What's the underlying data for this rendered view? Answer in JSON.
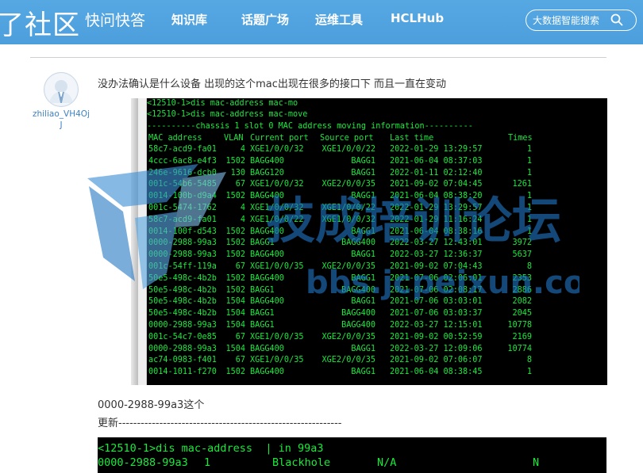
{
  "nav": {
    "brand": "了社区",
    "items": [
      "快问快答",
      "知识库",
      "话题广场",
      "运维工具",
      "HCLHub"
    ],
    "search_placeholder": "大数据智能搜索"
  },
  "post": {
    "username": "zhiliao_VH4OjJ",
    "text": "没办法确认是什么设备 出现的这个mac出现在很多的接口下 而且一直在变动",
    "mac_note": "0000-2988-99a3这个",
    "update_line": "更新------------------------------------------------------------"
  },
  "terminal1": {
    "commands": [
      "<12510-1>dis mac-address mac-mo",
      "<12510-1>dis mac-address mac-move"
    ],
    "banner": "----------chassis 1 slot 0 MAC address moving information----------",
    "headers": [
      "MAC address",
      "VLAN",
      "Current port",
      "Source port",
      "Last time",
      "Times"
    ],
    "rows": [
      [
        "58c7-acd9-fa01",
        "4",
        "XGE1/0/0/32",
        "XGE1/0/0/22",
        "2022-01-29 13:29:57",
        "1"
      ],
      [
        "4ccc-6ac8-e4f3",
        "1502",
        "BAGG400",
        "BAGG1",
        "2021-06-04 08:37:03",
        "1"
      ],
      [
        "246e-9616-dcb0",
        "130",
        "BAGG120",
        "BAGG1",
        "2022-01-11 02:12:40",
        "1"
      ],
      [
        "001c-54b6-5485",
        "67",
        "XGE1/0/0/32",
        "XGE2/0/0/35",
        "2021-09-02 07:04:45",
        "1261"
      ],
      [
        "0014-100b-d9a4",
        "1502",
        "BAGG400",
        "BAGG1",
        "2021-06-04 08:38:20",
        "1"
      ],
      [
        "001c-5474-1762",
        "4",
        "XGE1/0/0/32",
        "XGE1/0/0/22",
        "2022-01-29 13:29:57",
        "1"
      ],
      [
        "58c7-acd9-fa01",
        "4",
        "XGE1/0/0/22",
        "XGE1/0/0/32",
        "2022-01-29 11:16:24",
        "1"
      ],
      [
        "0014-100f-d543",
        "1502",
        "BAGG400",
        "BAGG1",
        "2021-06-04 08:38:16",
        "1"
      ],
      [
        "0000-2988-99a3",
        "1502",
        "BAGG1",
        "BAGG400",
        "2022-03-27 12:43:01",
        "3972"
      ],
      [
        "0000-2988-99a3",
        "1502",
        "BAGG400",
        "BAGG1",
        "2022-03-27 12:36:37",
        "5637"
      ],
      [
        "001c-54ff-119a",
        "67",
        "XGE1/0/0/35",
        "XGE2/0/0/35",
        "2021-09-02 07:04:43",
        "8"
      ],
      [
        "50e5-498c-4b2b",
        "1502",
        "BAGG400",
        "BAGG1",
        "2021-07-06 02:06:01",
        "2353"
      ],
      [
        "50e5-498c-4b2b",
        "1502",
        "BAGG1",
        "BAGG400",
        "2021-07-06 02:08:17",
        "2886"
      ],
      [
        "50e5-498c-4b2b",
        "1504",
        "BAGG400",
        "BAGG1",
        "2021-07-06 03:03:01",
        "2082"
      ],
      [
        "50e5-498c-4b2b",
        "1504",
        "BAGG1",
        "BAGG400",
        "2021-07-06 03:03:37",
        "2045"
      ],
      [
        "0000-2988-99a3",
        "1504",
        "BAGG1",
        "BAGG400",
        "2022-03-27 12:15:01",
        "10778"
      ],
      [
        "001c-54c7-0e85",
        "67",
        "XGE1/0/0/35",
        "XGE2/0/0/35",
        "2021-09-02 00:52:59",
        "2169"
      ],
      [
        "0000-2988-99a3",
        "1504",
        "BAGG400",
        "BAGG1",
        "2022-03-27 12:09:06",
        "10774"
      ],
      [
        "ac74-0983-f401",
        "67",
        "XGE1/0/0/35",
        "XGE2/0/0/35",
        "2021-09-02 07:06:07",
        "8"
      ],
      [
        "0014-1011-f270",
        "1502",
        "BAGG400",
        "BAGG1",
        "2021-06-04 08:38:45",
        "1"
      ]
    ]
  },
  "terminal2": {
    "command": "<12510-1>dis mac-address  | in 99a3",
    "row": [
      "0000-2988-99a3",
      "1",
      "Blackhole",
      "N/A",
      "N"
    ]
  },
  "watermark": {
    "title": "技成培训论坛",
    "url": "bbs.jcpeixun.com"
  },
  "colors": {
    "nav_bg": "#4c9fdc",
    "terminal_text": "#18ea3b",
    "link": "#3d82c4"
  }
}
